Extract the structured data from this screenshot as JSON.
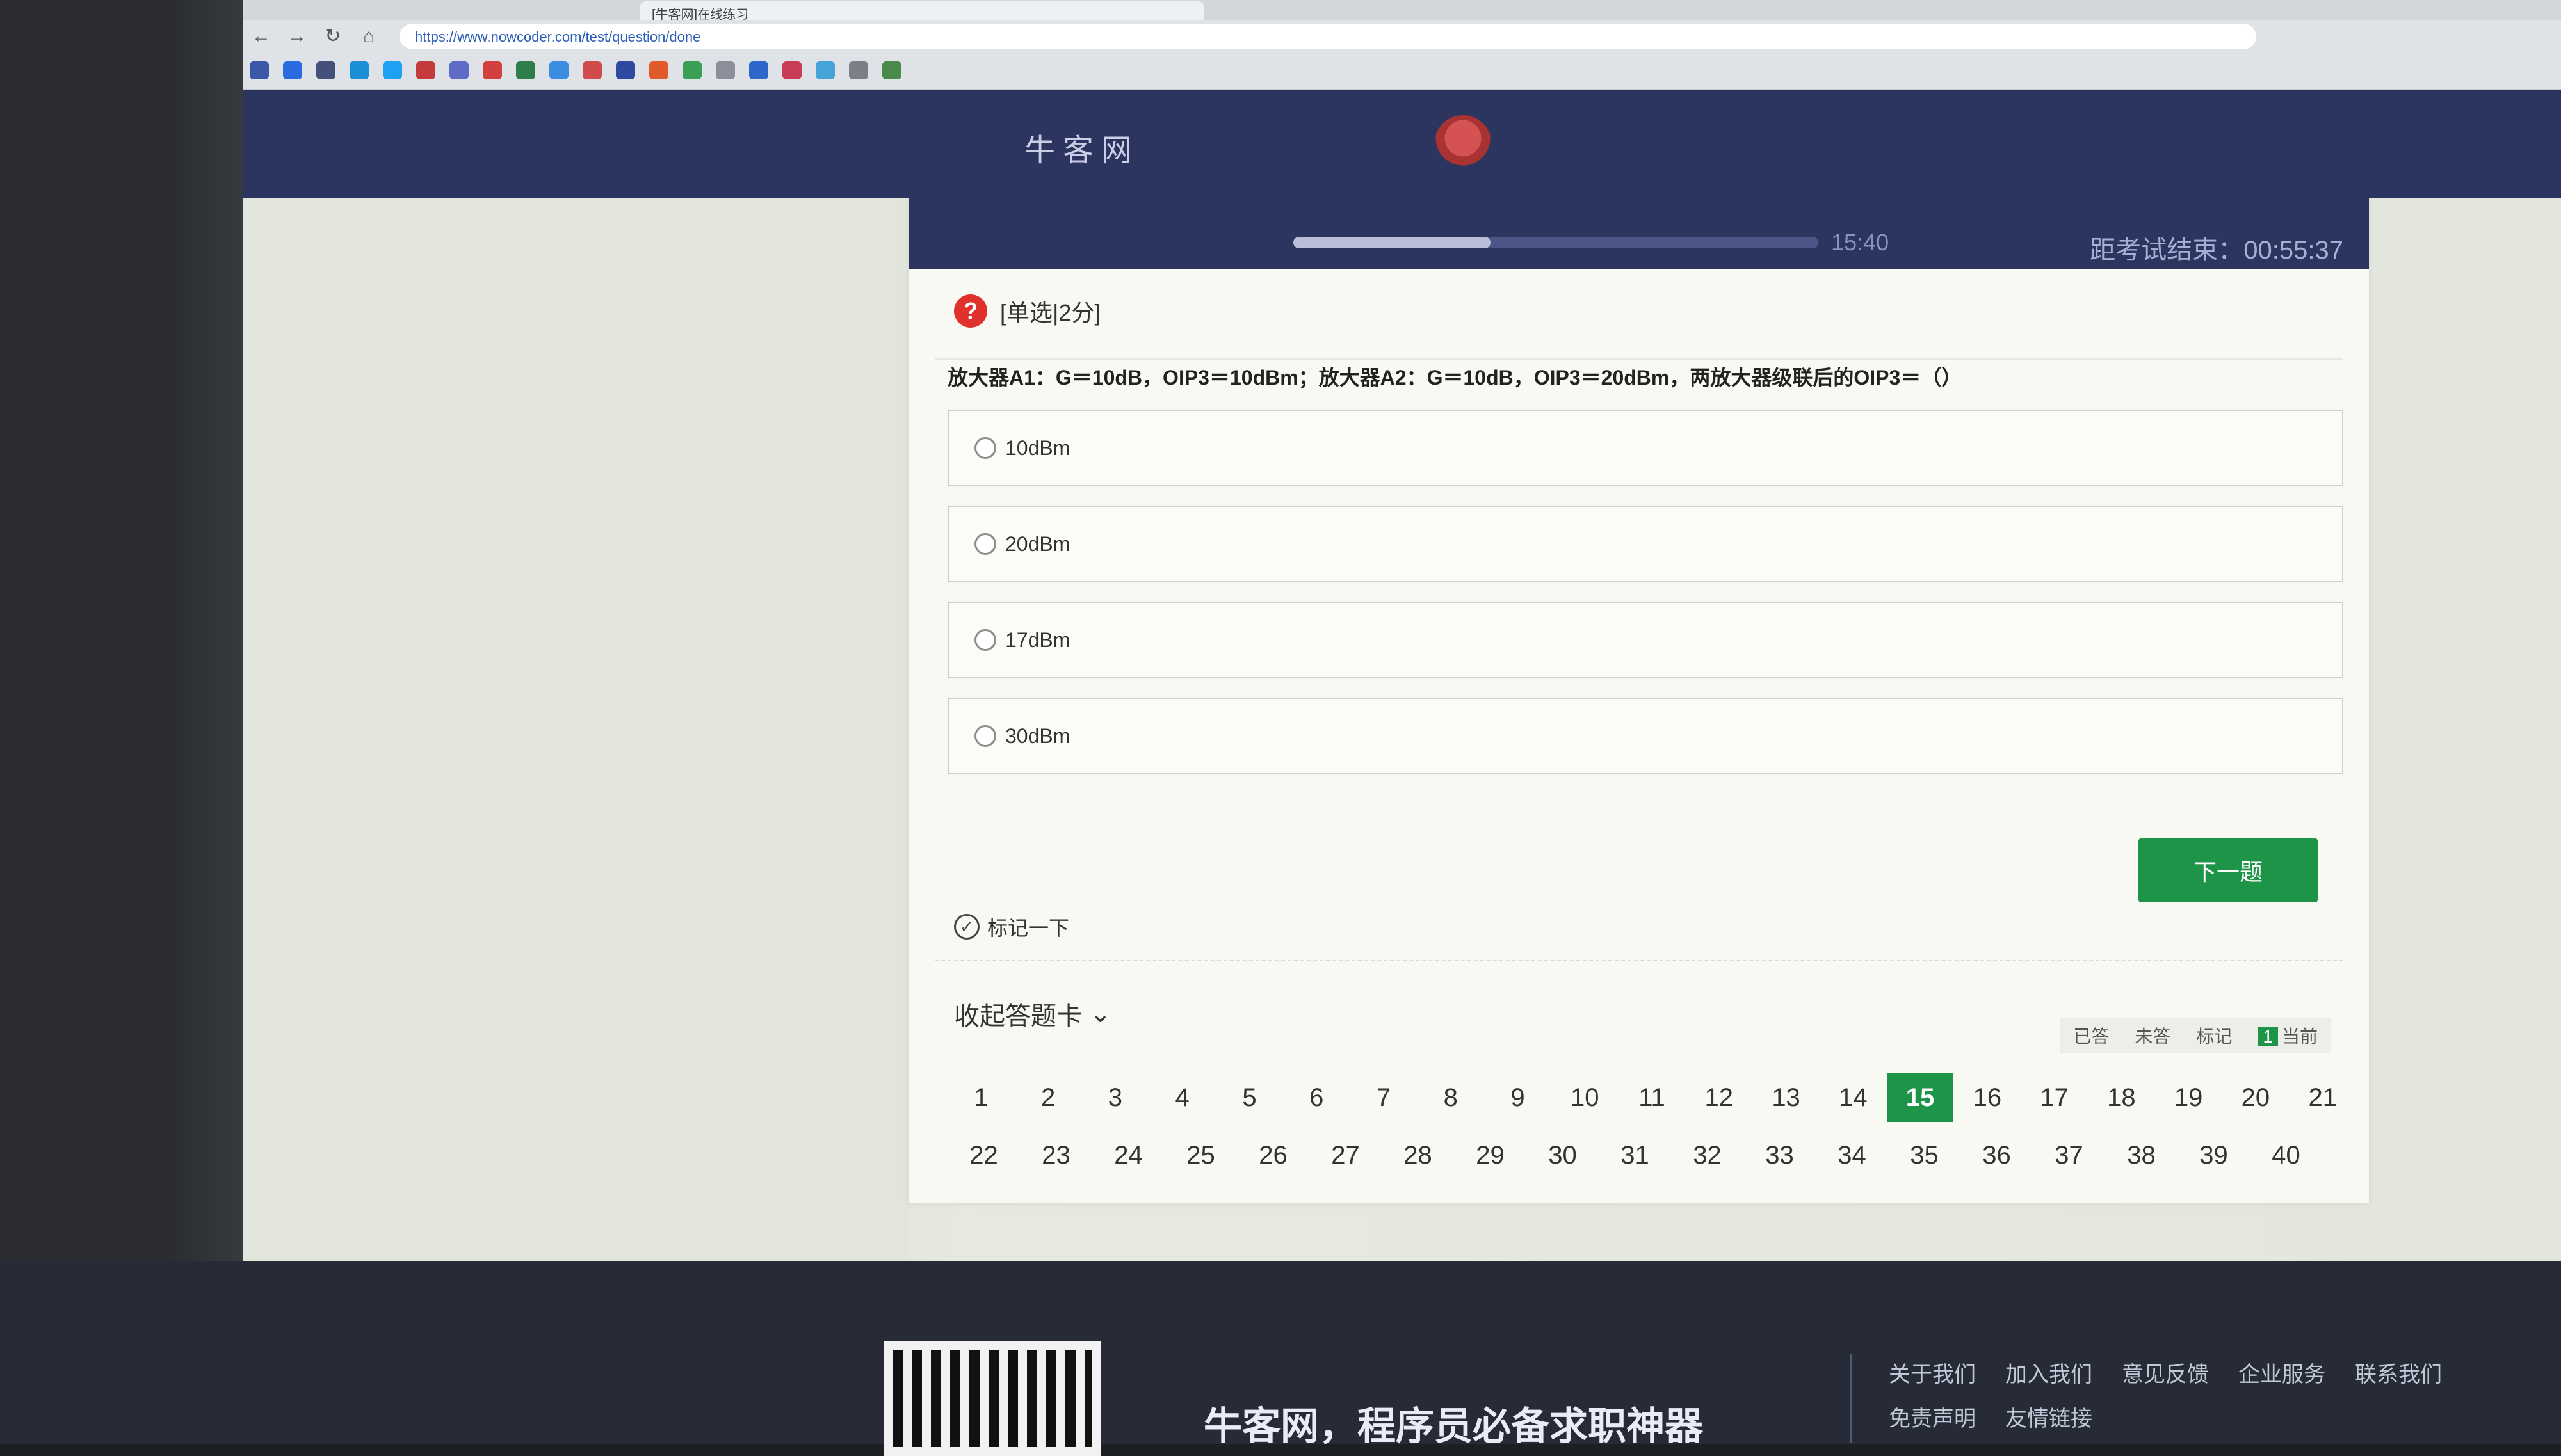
{
  "browser": {
    "tab_title": "[牛客网]在线练习",
    "url": "https://www.nowcoder.com/test/question/done",
    "nav": {
      "back": "←",
      "forward": "→",
      "reload": "↻",
      "home": "⌂"
    }
  },
  "site": {
    "logo_text": "牛客网"
  },
  "exam": {
    "remaining_label": "15:40",
    "progress_fraction": 0.375,
    "timer_label": "距考试结束：00:55:37",
    "question_type": "[单选|2分]",
    "question_icon": "?",
    "question_text": "放大器A1：G＝10dB，OIP3＝10dBm；放大器A2：G＝10dB，OIP3＝20dBm，两放大器级联后的OIP3＝（）",
    "options": [
      {
        "label": "10dBm"
      },
      {
        "label": "20dBm"
      },
      {
        "label": "17dBm"
      },
      {
        "label": "30dBm"
      }
    ],
    "next_button": "下一题",
    "mark_label": "标记一下",
    "mark_icon": "✓"
  },
  "answer_card": {
    "toggle_label": "收起答题卡",
    "toggle_icon": "⌄",
    "legend": {
      "answered": "已答",
      "unanswered": "未答",
      "marked": "标记",
      "current": "当前",
      "current_badge": "1"
    },
    "row1": [
      "1",
      "2",
      "3",
      "4",
      "5",
      "6",
      "7",
      "8",
      "9",
      "10",
      "11",
      "12",
      "13",
      "14",
      "15",
      "16",
      "17",
      "18",
      "19",
      "20",
      "21"
    ],
    "row2": [
      "22",
      "23",
      "24",
      "25",
      "26",
      "27",
      "28",
      "29",
      "30",
      "31",
      "32",
      "33",
      "34",
      "35",
      "36",
      "37",
      "38",
      "39",
      "40"
    ],
    "current": "15"
  },
  "footer": {
    "slogan": "牛客网，程序员必备求职神器",
    "links_row1": [
      "关于我们",
      "加入我们",
      "意见反馈",
      "企业服务",
      "联系我们"
    ],
    "links_row2": [
      "免责声明",
      "友情链接"
    ]
  },
  "colors": {
    "header_navy": "#2b3560",
    "accent_green": "#1e9448",
    "question_red": "#e0312d"
  }
}
